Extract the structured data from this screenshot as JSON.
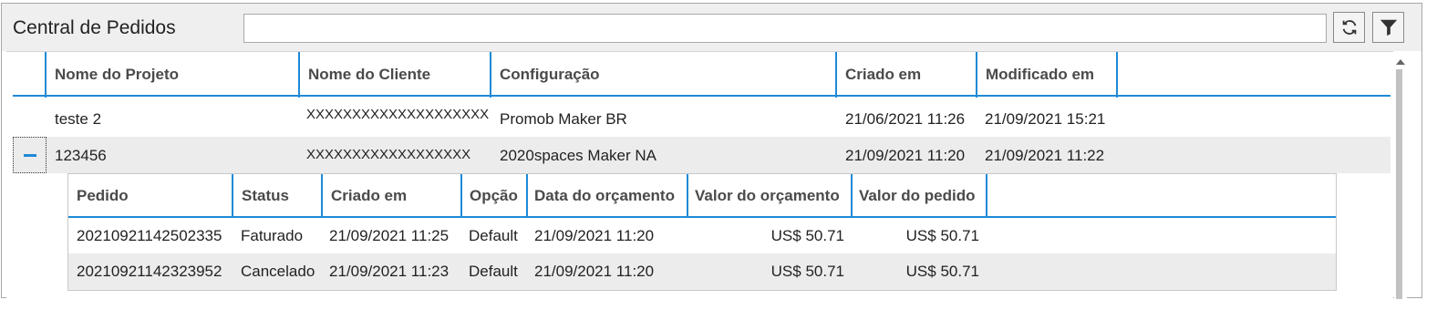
{
  "header": {
    "title": "Central de Pedidos",
    "search_value": "",
    "refresh_icon": "refresh-icon",
    "filter_icon": "filter-icon"
  },
  "grid": {
    "columns": [
      "Nome do Projeto",
      "Nome do Cliente",
      "Configuração",
      "Criado em",
      "Modificado em"
    ],
    "rows": [
      {
        "projeto": "teste 2",
        "cliente": "XXXXXXXXXXXXXXXXXXXX",
        "configuracao": "Promob Maker BR",
        "criado": "21/06/2021 11:26",
        "modificado": "21/09/2021 15:21"
      },
      {
        "projeto": "123456",
        "cliente": "XXXXXXXXXXXXXXXXXX",
        "configuracao": "2020spaces Maker NA",
        "criado": "21/09/2021 11:20",
        "modificado": "21/09/2021 11:22",
        "expanded": true
      }
    ],
    "expander_icon": "collapse-icon"
  },
  "detail": {
    "columns": [
      "Pedido",
      "Status",
      "Criado em",
      "Opção",
      "Data do orçamento",
      "Valor do orçamento",
      "Valor do pedido"
    ],
    "rows": [
      {
        "pedido": "20210921142502335",
        "status": "Faturado",
        "criado": "21/09/2021 11:25",
        "opcao": "Default",
        "data_orcamento": "21/09/2021 11:20",
        "valor_orcamento": "US$ 50.71",
        "valor_pedido": "US$ 50.71"
      },
      {
        "pedido": "20210921142323952",
        "status": "Cancelado",
        "criado": "21/09/2021 11:23",
        "opcao": "Default",
        "data_orcamento": "21/09/2021 11:20",
        "valor_orcamento": "US$ 50.71",
        "valor_pedido": "US$ 50.71"
      }
    ]
  },
  "colors": {
    "accent": "#1f8ad6",
    "header_bg": "#efefef",
    "row_alt": "#ececec"
  }
}
